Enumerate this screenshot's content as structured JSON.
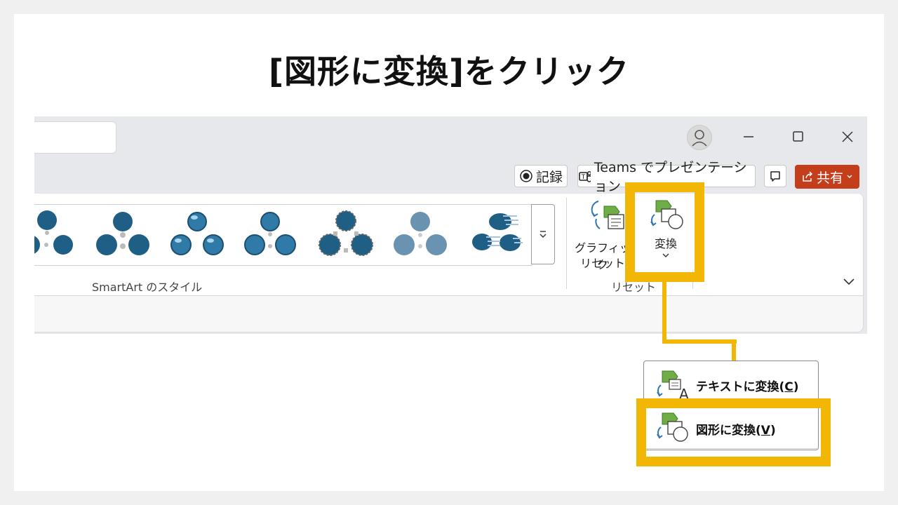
{
  "slide": {
    "title": "[図形に変換]をクリック"
  },
  "titlebar": {
    "icons": [
      "avatar-icon",
      "minimize-icon",
      "maximize-icon",
      "close-icon"
    ]
  },
  "quick_actions": {
    "record_label": "記録",
    "teams_label": "Teams でプレゼンテーション",
    "share_label": "共有",
    "share_color": "#c43e1c"
  },
  "ribbon": {
    "gallery_group_label": "SmartArt のスタイル",
    "reset_group_label": "リセット",
    "reset_graphic_label_line1": "グラフィック",
    "reset_graphic_label_line2": "リセット",
    "convert_label": "変換"
  },
  "menu": {
    "items": [
      {
        "label": "テキストに変換(",
        "key": "C",
        "suffix": ")"
      },
      {
        "label": "図形に変換(",
        "key": "V",
        "suffix": ")"
      }
    ]
  },
  "colors": {
    "highlight": "#f2b705",
    "smartart_blue": "#1f5f86",
    "icon_green": "#70ad47",
    "icon_blue": "#2e75b6"
  }
}
